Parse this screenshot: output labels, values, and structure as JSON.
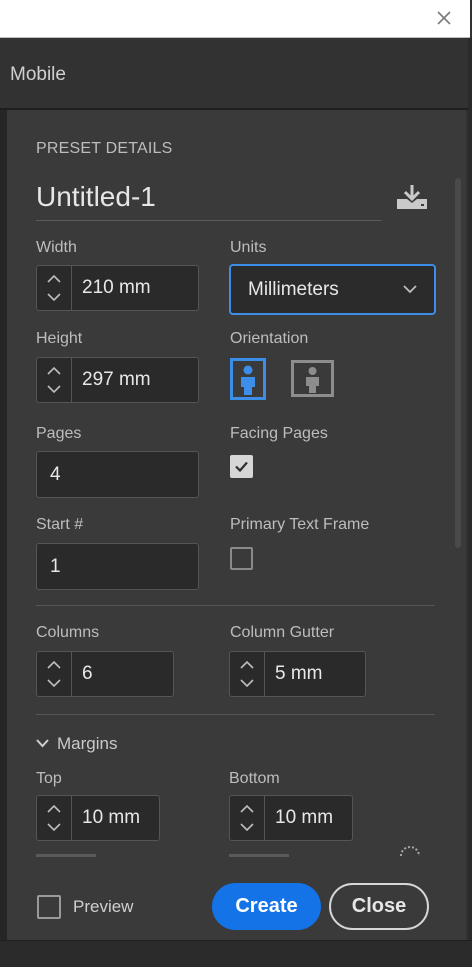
{
  "tab": {
    "label": "Mobile"
  },
  "preset": {
    "section_label": "PRESET DETAILS",
    "name": "Untitled-1"
  },
  "width": {
    "label": "Width",
    "value": "210 mm"
  },
  "units": {
    "label": "Units",
    "value": "Millimeters"
  },
  "height": {
    "label": "Height",
    "value": "297 mm"
  },
  "orientation": {
    "label": "Orientation",
    "selected": "portrait"
  },
  "pages": {
    "label": "Pages",
    "value": "4"
  },
  "facing_pages": {
    "label": "Facing Pages",
    "checked": true
  },
  "start": {
    "label": "Start #",
    "value": "1"
  },
  "primary_text_frame": {
    "label": "Primary Text Frame",
    "checked": false
  },
  "columns": {
    "label": "Columns",
    "value": "6"
  },
  "gutter": {
    "label": "Column Gutter",
    "value": "5 mm"
  },
  "margins": {
    "label": "Margins",
    "top": {
      "label": "Top",
      "value": "10 mm"
    },
    "bottom": {
      "label": "Bottom",
      "value": "10 mm"
    }
  },
  "footer": {
    "preview_label": "Preview",
    "preview_checked": false,
    "create_label": "Create",
    "close_label": "Close"
  },
  "colors": {
    "accent": "#1473e6",
    "panel": "#3a3a3a",
    "field": "#2a2a2a"
  }
}
